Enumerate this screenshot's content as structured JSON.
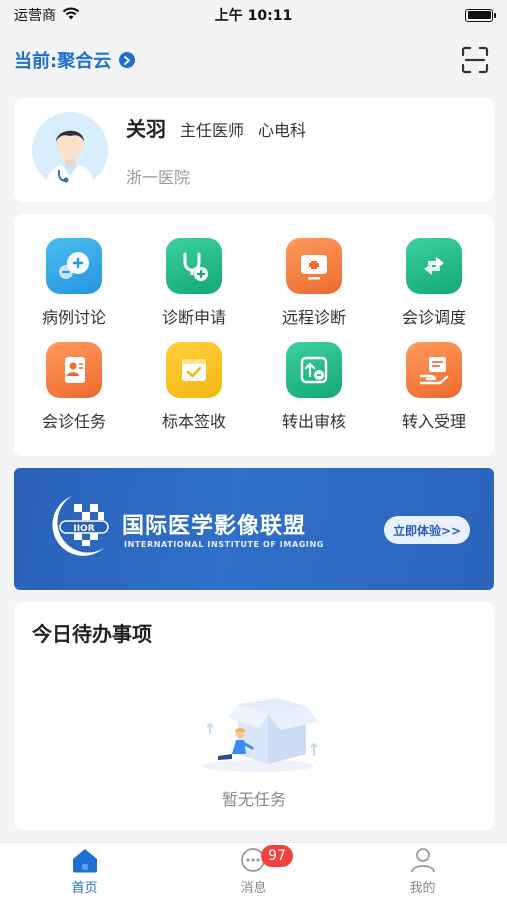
{
  "status_bar": {
    "carrier": "运营商",
    "time": "上午 10:11"
  },
  "header": {
    "current_platform": "当前:聚合云"
  },
  "profile": {
    "name": "关羽",
    "title": "主任医师",
    "department": "心电科",
    "hospital": "浙一医院"
  },
  "grid": [
    {
      "label": "病例讨论",
      "icon": "discussion-icon",
      "color": "#2ea8e8"
    },
    {
      "label": "诊断申请",
      "icon": "stethoscope-add-icon",
      "color": "#1fb98d"
    },
    {
      "label": "远程诊断",
      "icon": "monitor-cross-icon",
      "color": "#f2773a"
    },
    {
      "label": "会诊调度",
      "icon": "swap-arrows-icon",
      "color": "#1fb98d"
    },
    {
      "label": "会诊任务",
      "icon": "task-doc-icon",
      "color": "#f2773a"
    },
    {
      "label": "标本签收",
      "icon": "check-box-icon",
      "color": "#f2b712"
    },
    {
      "label": "转出审核",
      "icon": "transfer-out-icon",
      "color": "#1fb98d"
    },
    {
      "label": "转入受理",
      "icon": "transfer-in-icon",
      "color": "#f2773a"
    }
  ],
  "banner": {
    "title": "国际医学影像联盟",
    "subtitle": "INTERNATIONAL INSTITUTE OF IMAGING",
    "logo_text": "IIOR",
    "cta": "立即体验>>"
  },
  "todo": {
    "title": "今日待办事项",
    "empty_text": "暂无任务"
  },
  "tabs": [
    {
      "label": "首页",
      "icon": "home-icon",
      "active": true
    },
    {
      "label": "消息",
      "icon": "message-icon",
      "active": false,
      "badge": "97"
    },
    {
      "label": "我的",
      "icon": "user-icon",
      "active": false
    }
  ],
  "colors": {
    "accent": "#1e6fd0",
    "badge": "#f04040",
    "banner": "#2a61b8"
  }
}
